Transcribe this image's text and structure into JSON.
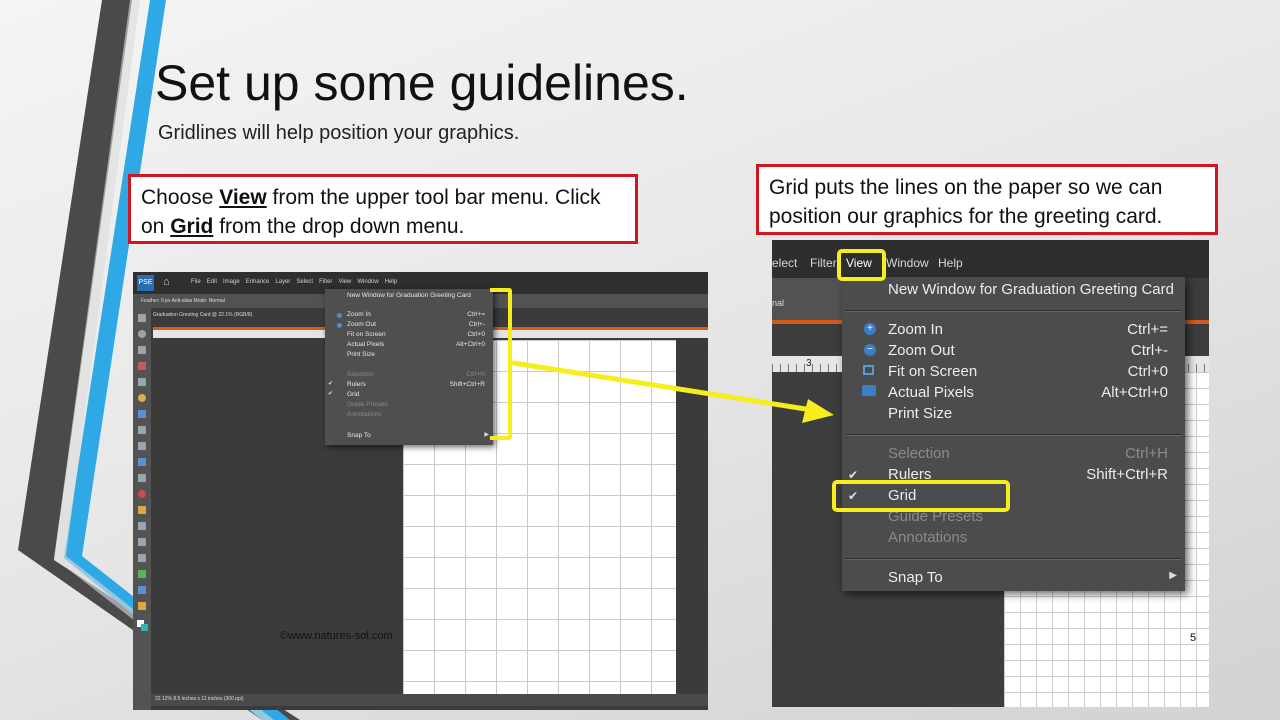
{
  "slide": {
    "title": "Set up some guidelines.",
    "subtitle": "Gridlines will help position your graphics.",
    "footer": "©www.natures-sol.com",
    "page_number": "5"
  },
  "callout_left": {
    "t1": "Choose ",
    "k1": "View",
    "t2": " from the upper tool bar menu. Click on ",
    "k2": "Grid",
    "t3": " from the drop down menu."
  },
  "callout_right": {
    "text": "Grid puts the lines on the paper so we can position our graphics for the greeting card."
  },
  "colors": {
    "callout_border": "#d0161e",
    "highlight": "#f6ee1c",
    "orange_bar": "#d65a1a",
    "blue_accent": "#2fa8e6"
  },
  "screenshot_left": {
    "logo": "PSE",
    "menus": [
      "File",
      "Edit",
      "Image",
      "Enhance",
      "Layer",
      "Select",
      "Filter",
      "View",
      "Window",
      "Help"
    ],
    "options": "Feather: 0 px    Anti-alias    Mode: Normal",
    "doc_tab": "Graduation Greeting Card @ 22.1% (RGB/8)",
    "status": "22.12%     8.5 inches x 11 inches (300 ppi)",
    "menu_items": [
      {
        "label": "New Window for Graduation Greeting Card",
        "shortcut": ""
      },
      {
        "label": "Zoom In",
        "shortcut": "Ctrl+="
      },
      {
        "label": "Zoom Out",
        "shortcut": "Ctrl+-"
      },
      {
        "label": "Fit on Screen",
        "shortcut": "Ctrl+0"
      },
      {
        "label": "Actual Pixels",
        "shortcut": "Alt+Ctrl+0"
      },
      {
        "label": "Print Size",
        "shortcut": ""
      },
      {
        "label": "Selection",
        "shortcut": "Ctrl+H"
      },
      {
        "label": "Rulers",
        "shortcut": "Shift+Ctrl+R"
      },
      {
        "label": "Grid",
        "shortcut": ""
      },
      {
        "label": "Guide Presets",
        "shortcut": ""
      },
      {
        "label": "Annotations",
        "shortcut": ""
      },
      {
        "label": "Snap To",
        "shortcut": ""
      }
    ]
  },
  "screenshot_right": {
    "menus": [
      "elect",
      "Filter",
      "View",
      "Window",
      "Help"
    ],
    "options_mode": "nal",
    "ruler_mark": "3",
    "menu_items": [
      {
        "label": "New Window for Graduation Greeting Card",
        "shortcut": ""
      },
      {
        "label": "Zoom In",
        "shortcut": "Ctrl+="
      },
      {
        "label": "Zoom Out",
        "shortcut": "Ctrl+-"
      },
      {
        "label": "Fit on Screen",
        "shortcut": "Ctrl+0"
      },
      {
        "label": "Actual Pixels",
        "shortcut": "Alt+Ctrl+0"
      },
      {
        "label": "Print Size",
        "shortcut": ""
      },
      {
        "label": "Selection",
        "shortcut": "Ctrl+H"
      },
      {
        "label": "Rulers",
        "shortcut": "Shift+Ctrl+R"
      },
      {
        "label": "Grid",
        "shortcut": ""
      },
      {
        "label": "Guide Presets",
        "shortcut": ""
      },
      {
        "label": "Annotations",
        "shortcut": ""
      },
      {
        "label": "Snap To",
        "shortcut": ""
      }
    ]
  }
}
